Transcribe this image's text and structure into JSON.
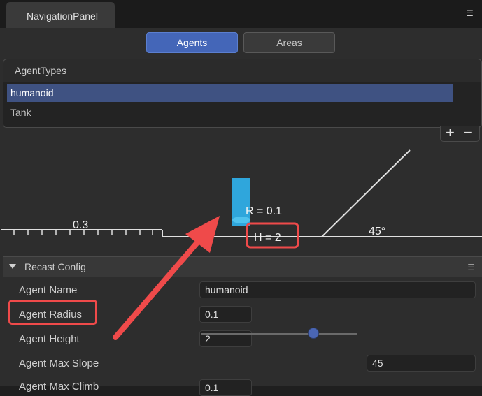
{
  "window": {
    "tab_label": "NavigationPanel",
    "menu_icon": "hamburger-icon"
  },
  "tabs": {
    "agents": "Agents",
    "areas": "Areas"
  },
  "agent_types": {
    "header": "AgentTypes",
    "items": [
      "humanoid",
      "Tank"
    ],
    "selected": "humanoid",
    "add_label": "+",
    "remove_label": "−"
  },
  "diagram": {
    "step_height": "0.3",
    "radius": "R = 0.1",
    "height": "H = 2",
    "slope": "45°"
  },
  "recast": {
    "title": "Recast Config",
    "labels": {
      "agent_name": "Agent Name",
      "agent_radius": "Agent Radius",
      "agent_height": "Agent Height",
      "agent_max_slope": "Agent Max Slope",
      "agent_max_climb": "Agent Max Climb"
    },
    "values": {
      "agent_name": "humanoid",
      "agent_radius": "0.1",
      "agent_height": "2",
      "agent_max_slope": "45",
      "agent_max_climb": "0.1"
    },
    "slope_slider_fraction": 0.72
  },
  "colors": {
    "accent": "#4466b8",
    "annotation": "#ef4a4a",
    "agent_cylinder": "#2fa6dc"
  }
}
